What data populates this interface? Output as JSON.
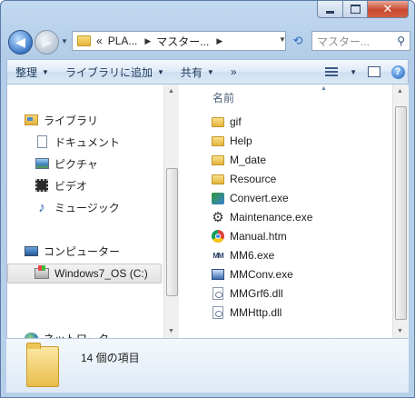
{
  "window": {
    "caption_buttons": {
      "minimize": "",
      "maximize": "",
      "close": "✕"
    }
  },
  "navigation": {
    "back_glyph": "◀",
    "forward_glyph": "▶",
    "address_prefix": "«",
    "breadcrumbs": [
      "PLA...",
      "マスター..."
    ],
    "search_placeholder": "マスター...の検索",
    "search_display": "マスター..."
  },
  "toolbar": {
    "organize": "整理",
    "add_to_library": "ライブラリに追加",
    "share": "共有",
    "more": "»",
    "help": "?"
  },
  "sidebar": {
    "libraries": "ライブラリ",
    "items": [
      {
        "label": "ドキュメント",
        "icon": "document-icon"
      },
      {
        "label": "ピクチャ",
        "icon": "picture-icon"
      },
      {
        "label": "ビデオ",
        "icon": "video-icon"
      },
      {
        "label": "ミュージック",
        "icon": "music-icon"
      }
    ],
    "computer": "コンピューター",
    "drive": "Windows7_OS (C:)",
    "network": "ネットワーク"
  },
  "file_list": {
    "column_header": "名前",
    "sort_glyph": "▲",
    "files": [
      {
        "name": "gif",
        "icon": "folder-icon"
      },
      {
        "name": "Help",
        "icon": "folder-icon"
      },
      {
        "name": "M_date",
        "icon": "folder-icon"
      },
      {
        "name": "Resource",
        "icon": "folder-icon"
      },
      {
        "name": "Convert.exe",
        "icon": "convert-exe-icon"
      },
      {
        "name": "Maintenance.exe",
        "icon": "gear-icon"
      },
      {
        "name": "Manual.htm",
        "icon": "chrome-icon"
      },
      {
        "name": "MM6.exe",
        "icon": "mm6-icon"
      },
      {
        "name": "MMConv.exe",
        "icon": "mmconv-icon"
      },
      {
        "name": "MMGrf6.dll",
        "icon": "dll-icon"
      },
      {
        "name": "MMHttp.dll",
        "icon": "dll-icon"
      }
    ]
  },
  "details": {
    "item_count": "14 個の項目"
  }
}
